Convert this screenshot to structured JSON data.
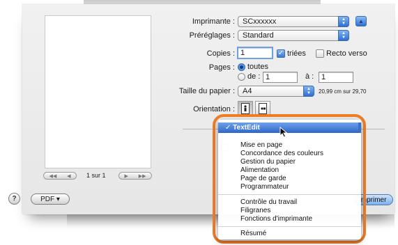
{
  "dialog": {
    "printer_label": "Imprimante :",
    "printer_value": "SCxxxxxx",
    "presets_label": "Préréglages :",
    "presets_value": "Standard",
    "copies_label": "Copies :",
    "copies_value": "1",
    "collated_label": "triées",
    "collated_checked": true,
    "duplex_label": "Recto verso",
    "duplex_checked": false,
    "pages_label": "Pages :",
    "pages_all_label": "toutes",
    "pages_from_label": "de :",
    "pages_from_value": "1",
    "pages_to_label": "à :",
    "pages_to_value": "1",
    "paper_size_label": "Taille du papier :",
    "paper_size_value": "A4",
    "paper_size_dims": "20,99 cm sur 29,70",
    "orientation_label": "Orientation :"
  },
  "preview": {
    "page_counter": "1 sur 1"
  },
  "footer": {
    "help_label": "?",
    "pdf_label": "PDF ▾",
    "print_label": "Imprimer"
  },
  "menu": {
    "selected_item": "✓ TextEdit",
    "group1": [
      "Mise en page",
      "Concordance des couleurs",
      "Gestion du papier",
      "Alimentation",
      "Page de garde",
      "Programmateur"
    ],
    "group2": [
      "Contrôle du travail",
      "Filigranes",
      "Fonctions d'imprimante"
    ],
    "group3": [
      "Résumé"
    ]
  },
  "colors": {
    "highlight": "#ef7d27",
    "accent": "#2e66c8"
  },
  "icons": {
    "help": "question-mark",
    "popup_arrows": "up-down-arrows",
    "disclosure": "triangle-up",
    "portrait": "portrait-page-person",
    "landscape": "landscape-page-person",
    "cursor": "mouse-pointer-arrow"
  }
}
